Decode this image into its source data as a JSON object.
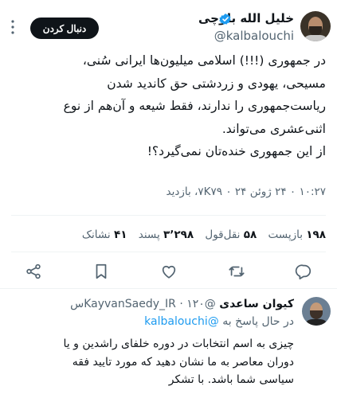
{
  "tweet": {
    "author": {
      "display_name": "خلیل الله بلوچی",
      "handle": "@kalbalouchi",
      "verified": true
    },
    "follow_label": "دنبال کردن",
    "text": "در جمهوری (!!!) اسلامی میلیون‌ها ایرانی سُنی،\nمسیحی، یهودی و زردشتی حق کاندید شدن\nریاست‌جمهوری را ندارند، فقط شیعه و آن‌هم از نوع\nاثنی‌عشری می‌تواند.\nاز این جمهوری خنده‌تان نمی‌گیرد؟!",
    "meta": "۱۰:۲۷ ۰ ۲۴ ژوئن ۲۴ ۰ ۷K۷۹، بازدید",
    "stats": {
      "retweets_count": "۱۹۸",
      "retweets_label": "بازپست",
      "quotes_count": "۵۸",
      "quotes_label": "نقل‌قول",
      "likes_count": "۳٬۲۹۸",
      "likes_label": "پسند",
      "bookmarks_count": "۴۱",
      "bookmarks_label": "نشانک"
    },
    "actions": [
      "reply-icon",
      "retweet-icon",
      "like-icon",
      "bookmark-icon",
      "share-icon"
    ]
  },
  "reply": {
    "display_name": "کیوان ساعدی",
    "handle": "@KayvanSaedy_IR",
    "dot": "·",
    "time": "۱۲۰س",
    "replying_prefix": "در حال پاسخ به",
    "replying_to": "@kalbalouchi",
    "text": "چیزی به اسم انتخابات در دوره خلفای راشدین و یا\nدوران معاصر به ما نشان دهید که مورد تایید فقه\nسیاسی شما باشد. با تشکر"
  },
  "colors": {
    "text": "#0f1419",
    "secondary": "#536471",
    "accent": "#1d9bf0",
    "verified": "#1d9bf0"
  }
}
